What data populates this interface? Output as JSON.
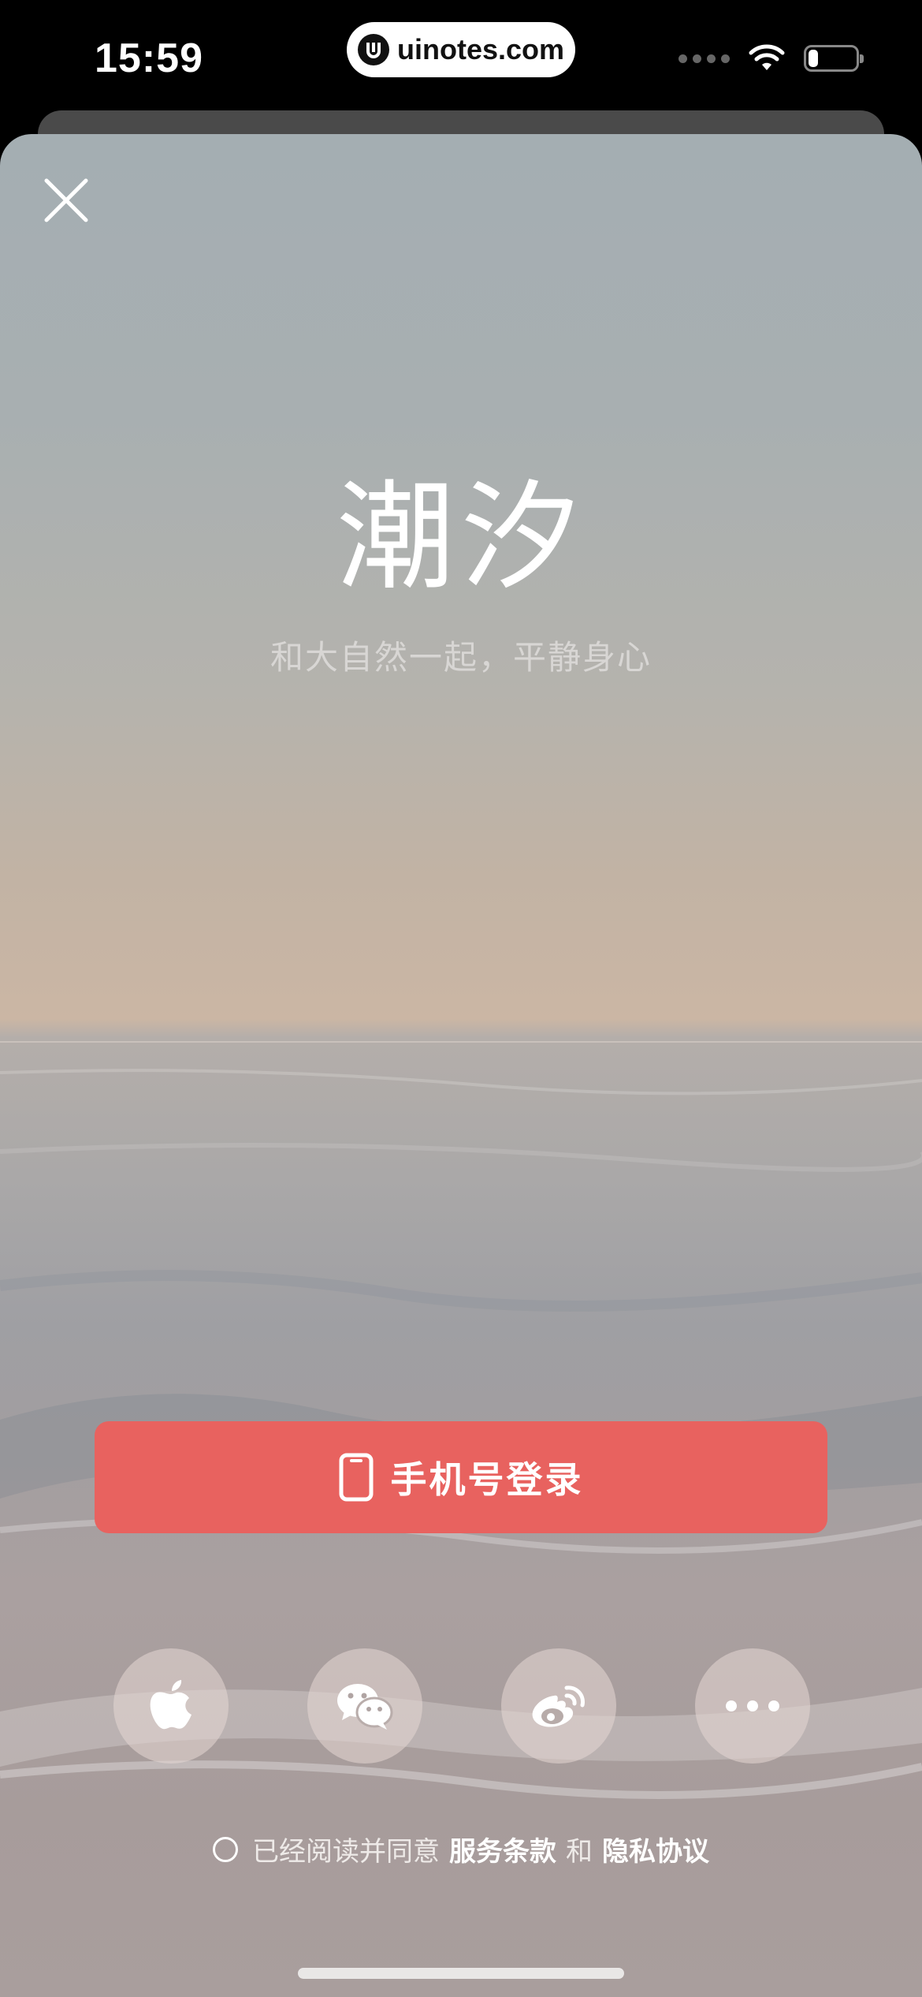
{
  "status_bar": {
    "time": "15:59",
    "url": "uinotes.com",
    "battery_level": 0.2
  },
  "colors": {
    "accent": "#e8625f",
    "text_primary": "#ffffff"
  },
  "header": {
    "close_icon": "close-icon"
  },
  "brand": {
    "title": "潮汐",
    "subtitle": "和大自然一起，平静身心"
  },
  "login": {
    "phone_label": "手机号登录",
    "phone_icon": "phone-icon"
  },
  "social": {
    "items": [
      {
        "name": "apple",
        "icon": "apple-icon"
      },
      {
        "name": "wechat",
        "icon": "wechat-icon"
      },
      {
        "name": "weibo",
        "icon": "weibo-icon"
      },
      {
        "name": "more",
        "icon": "more-icon"
      }
    ]
  },
  "agreement": {
    "prefix": "已经阅读并同意",
    "terms": "服务条款",
    "and": "和",
    "privacy": "隐私协议",
    "checked": false
  }
}
